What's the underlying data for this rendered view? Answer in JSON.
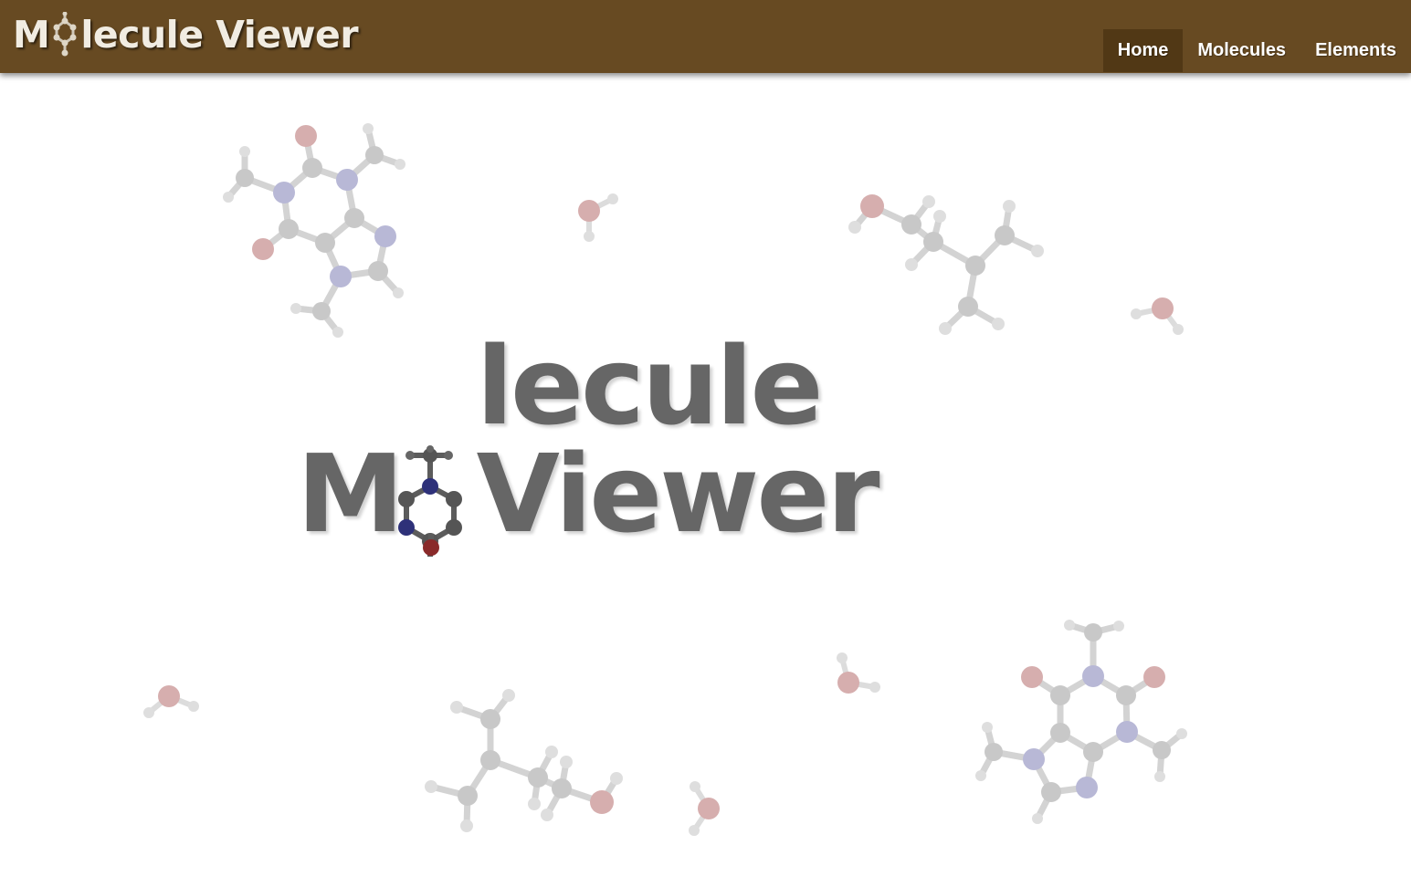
{
  "app": {
    "brand_left": "M",
    "brand_right": "lecule Viewer",
    "hero_left": "M",
    "hero_right": "lecule Viewer"
  },
  "nav": {
    "items": [
      {
        "label": "Home",
        "active": true
      },
      {
        "label": "Molecules",
        "active": false
      },
      {
        "label": "Elements",
        "active": false
      }
    ]
  },
  "colors": {
    "header": "#674a22",
    "nav_active": "#513815",
    "hero_text": "#666666",
    "carbon": "#c8c8c8",
    "nitrogen": "#b6b6d6",
    "oxygen": "#d6aeae"
  },
  "icons": {
    "brand_logo": "molecule-ring-icon",
    "hero_logo": "molecule-ring-icon"
  }
}
